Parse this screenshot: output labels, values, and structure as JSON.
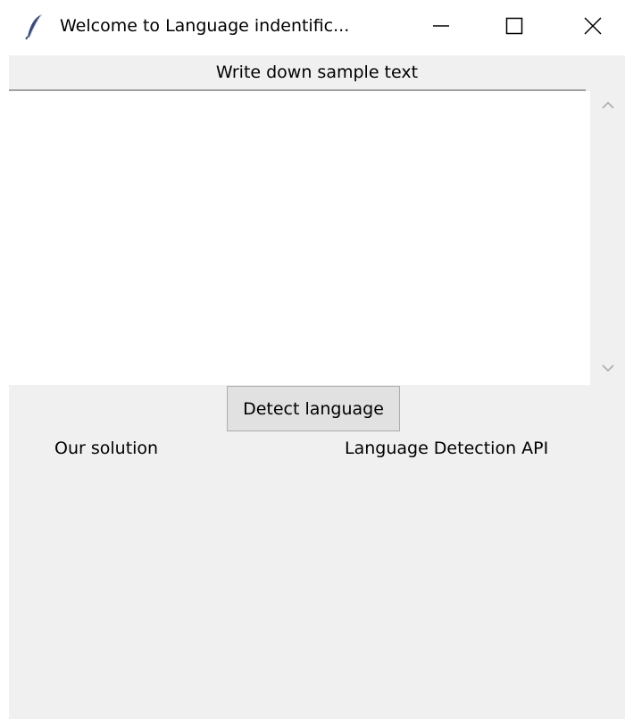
{
  "window": {
    "title": "Welcome to Language indentific...",
    "icon": "feather-icon",
    "controls": [
      "minimize-icon",
      "maximize-icon",
      "close-icon"
    ]
  },
  "form": {
    "prompt_label": "Write down sample text",
    "text_value": "",
    "detect_button_label": "Detect language"
  },
  "results": {
    "our_solution_label": "Our solution",
    "api_label": "Language Detection API"
  },
  "colors": {
    "window_bg": "#f0f0f0",
    "input_bg": "#ffffff",
    "button_bg": "#e1e1e1"
  }
}
